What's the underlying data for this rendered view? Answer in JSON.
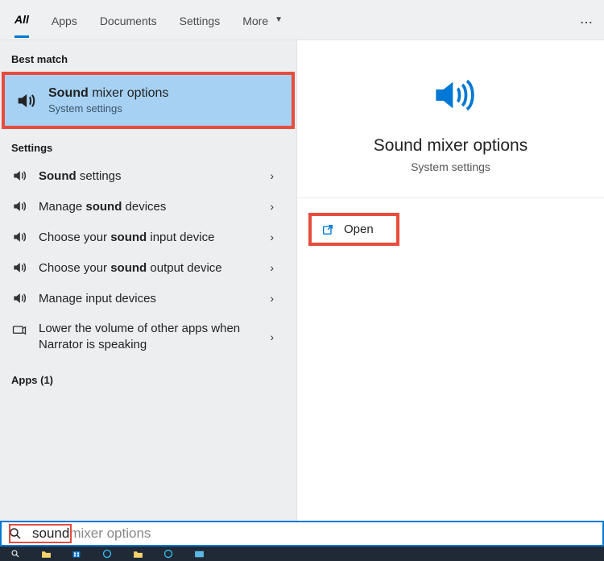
{
  "tabs": {
    "items": [
      "All",
      "Apps",
      "Documents",
      "Settings",
      "More"
    ],
    "active_index": 0
  },
  "left": {
    "best_match_header": "Best match",
    "best_match": {
      "title_bold": "Sound",
      "title_rest": " mixer options",
      "subtitle": "System settings"
    },
    "settings_header": "Settings",
    "settings": [
      {
        "icon": "speaker",
        "prefix_bold": "Sound",
        "rest": " settings"
      },
      {
        "icon": "speaker",
        "prefix": "Manage ",
        "mid_bold": "sound",
        "rest": " devices"
      },
      {
        "icon": "speaker",
        "prefix": "Choose your ",
        "mid_bold": "sound",
        "rest": " input device"
      },
      {
        "icon": "speaker",
        "prefix": "Choose your ",
        "mid_bold": "sound",
        "rest": " output device"
      },
      {
        "icon": "speaker",
        "text": "Manage input devices"
      },
      {
        "icon": "gear",
        "text": "Lower the volume of other apps when Narrator is speaking",
        "multiline": true
      }
    ],
    "apps_header": "Apps (1)"
  },
  "right": {
    "title": "Sound mixer options",
    "subtitle": "System settings",
    "open_label": "Open"
  },
  "search": {
    "typed": "sound",
    "completion": " mixer options"
  },
  "highlight_color": "#e74c3c",
  "accent_color": "#0078d4"
}
